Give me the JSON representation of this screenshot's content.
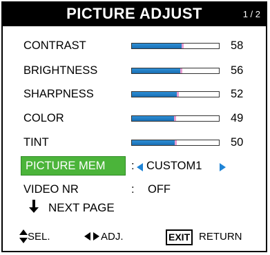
{
  "header": {
    "title": "PICTURE ADJUST",
    "page_indicator": "1 / 2"
  },
  "settings": [
    {
      "label": "CONTRAST",
      "value": "58",
      "level": 0.58
    },
    {
      "label": "BRIGHTNESS",
      "value": "56",
      "level": 0.56
    },
    {
      "label": "SHARPNESS",
      "value": "52",
      "level": 0.52
    },
    {
      "label": "COLOR",
      "value": "49",
      "level": 0.49
    },
    {
      "label": "TINT",
      "value": "50",
      "level": 0.5
    }
  ],
  "picture_mem": {
    "label": "PICTURE MEM",
    "separator": ":",
    "value": "CUSTOM1"
  },
  "video_nr": {
    "label": "VIDEO NR",
    "separator": ":",
    "value": "OFF"
  },
  "next_page": {
    "label": "NEXT PAGE"
  },
  "footer": {
    "select_label": "SEL.",
    "adjust_label": "ADJ.",
    "exit_key": "EXIT",
    "return_label": "RETURN"
  },
  "colors": {
    "bar_fill": "#1a6fb4",
    "bar_marker": "#e79bd0",
    "selection": "#4bb43a",
    "arrow": "#1f84d6"
  }
}
